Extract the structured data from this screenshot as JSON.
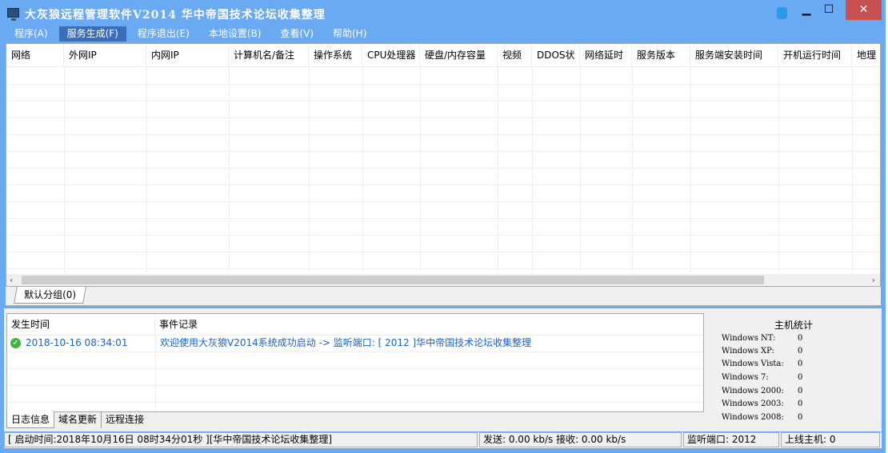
{
  "title": "大灰狼远程管理软件V2014   华中帝国技术论坛收集整理",
  "window_controls": {
    "minimize": "▁",
    "maximize": "☐",
    "close": "✕"
  },
  "menu": [
    "程序(A)",
    "服务生成(F)",
    "程序退出(E)",
    "本地设置(B)",
    "查看(V)",
    "帮助(H)"
  ],
  "columns": [
    "网络",
    "外网IP",
    "内网IP",
    "计算机名/备注",
    "操作系统",
    "CPU处理器",
    "硬盘/内存容量",
    "视频",
    "DDOS状",
    "网络延时",
    "服务版本",
    "服务端安装时间",
    "开机运行时间",
    "地理"
  ],
  "scroll": {
    "left": "‹",
    "right": "›"
  },
  "group_tab": "默认分组(0)",
  "log": {
    "headers": [
      "发生时间",
      "事件记录"
    ],
    "rows": [
      {
        "time": "2018-10-16 08:34:01",
        "event": "欢迎使用大灰狼V2014系统成功启动 -> 监听端口: [ 2012 ]华中帝国技术论坛收集整理"
      }
    ]
  },
  "stats": {
    "title": "主机统计",
    "rows": [
      {
        "label": "Windows NT:",
        "value": "0"
      },
      {
        "label": "Windows XP:",
        "value": "0"
      },
      {
        "label": "Windows Vista:",
        "value": "0"
      },
      {
        "label": "Windows 7:",
        "value": "0"
      },
      {
        "label": "Windows 2000:",
        "value": "0"
      },
      {
        "label": "Windows 2003:",
        "value": "0"
      },
      {
        "label": "Windows 2008:",
        "value": "0"
      }
    ]
  },
  "bottom_tabs": [
    "日志信息",
    "域名更新",
    "远程连接"
  ],
  "status": {
    "start": "[ 启动时间:2018年10月16日 08时34分01秒 ][华中帝国技术论坛收集整理]",
    "traffic": "发送: 0.00 kb/s 接收: 0.00 kb/s",
    "port": "监听端口: 2012",
    "online": "上线主机: 0"
  }
}
